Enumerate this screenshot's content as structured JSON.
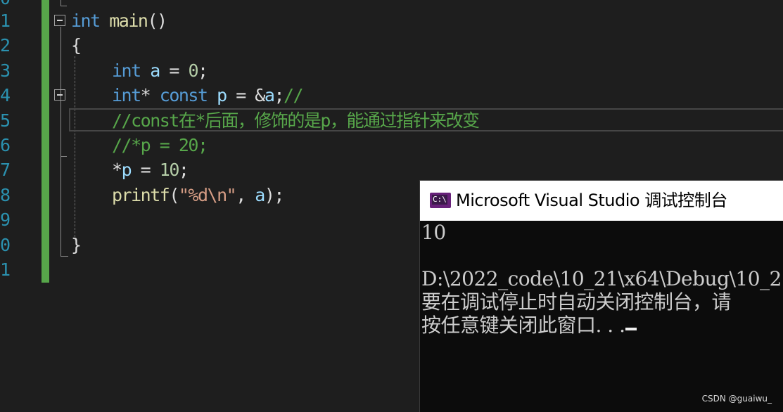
{
  "editor": {
    "line_numbers": [
      "0",
      "1",
      "2",
      "3",
      "4",
      "5",
      "6",
      "7",
      "8",
      "9",
      "0",
      "1"
    ],
    "lines": [
      {
        "tokens": [
          {
            "cls": "kw",
            "t": "int"
          },
          {
            "cls": "op",
            "t": " "
          },
          {
            "cls": "fn",
            "t": "main"
          },
          {
            "cls": "op",
            "t": "()"
          }
        ]
      },
      {
        "tokens": [
          {
            "cls": "op",
            "t": "{"
          }
        ]
      },
      {
        "tokens": [
          {
            "cls": "kw",
            "t": "int"
          },
          {
            "cls": "op",
            "t": " "
          },
          {
            "cls": "var",
            "t": "a"
          },
          {
            "cls": "op",
            "t": " = "
          },
          {
            "cls": "num",
            "t": "0"
          },
          {
            "cls": "op",
            "t": ";"
          }
        ]
      },
      {
        "tokens": [
          {
            "cls": "kw",
            "t": "int"
          },
          {
            "cls": "op",
            "t": "* "
          },
          {
            "cls": "kw",
            "t": "const"
          },
          {
            "cls": "op",
            "t": " "
          },
          {
            "cls": "var",
            "t": "p"
          },
          {
            "cls": "op",
            "t": " = &"
          },
          {
            "cls": "var",
            "t": "a"
          },
          {
            "cls": "op",
            "t": ";"
          },
          {
            "cls": "cm",
            "t": "//"
          }
        ]
      },
      {
        "tokens": [
          {
            "cls": "cm",
            "t": "//const在*后面，修饰的是p，能通过指针来改变"
          }
        ]
      },
      {
        "tokens": [
          {
            "cls": "cm",
            "t": "//*p = 20;"
          }
        ]
      },
      {
        "tokens": [
          {
            "cls": "op",
            "t": "*"
          },
          {
            "cls": "var",
            "t": "p"
          },
          {
            "cls": "op",
            "t": " = "
          },
          {
            "cls": "num",
            "t": "10"
          },
          {
            "cls": "op",
            "t": ";"
          }
        ]
      },
      {
        "tokens": [
          {
            "cls": "fn",
            "t": "printf"
          },
          {
            "cls": "op",
            "t": "("
          },
          {
            "cls": "str",
            "t": "\"%d\\n\""
          },
          {
            "cls": "op",
            "t": ", "
          },
          {
            "cls": "var",
            "t": "a"
          },
          {
            "cls": "op",
            "t": ");"
          }
        ]
      },
      {
        "tokens": []
      },
      {
        "tokens": [
          {
            "cls": "op",
            "t": "}"
          }
        ]
      }
    ]
  },
  "console": {
    "title": "Microsoft Visual Studio 调试控制台",
    "icon": "console-app-icon",
    "icon_text": "C:\\",
    "output_lines": [
      "10",
      "",
      "D:\\2022_code\\10_21\\x64\\Debug\\10_2",
      "要在调试停止时自动关闭控制台，请",
      "按任意键关闭此窗口. . ."
    ]
  },
  "watermark": "CSDN @guaiwu_",
  "colors": {
    "keyword": "#569cd6",
    "function": "#dcdcaa",
    "variable": "#9cdcfe",
    "number": "#b5cea8",
    "string": "#d69d85",
    "comment": "#57a64a",
    "editor_bg": "#1e1e1e",
    "console_bg": "#0c0c0c"
  }
}
